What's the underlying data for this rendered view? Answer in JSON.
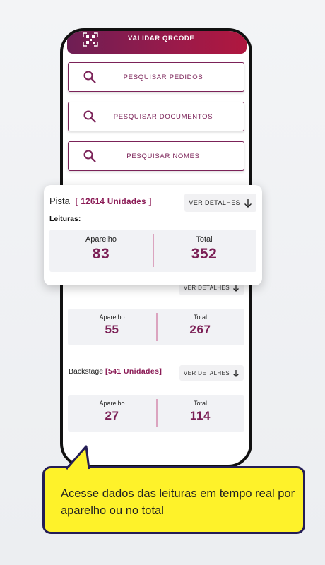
{
  "header": {
    "qr_label": "VALIDAR QRCODE",
    "icon": "qrcode-icon"
  },
  "search": {
    "orders_label": "PESQUISAR PEDIDOS",
    "documents_label": "PESQUISAR DOCUMENTOS",
    "names_label": "PESQUISAR NOMES",
    "icon": "search-icon"
  },
  "featured": {
    "name": "Pista",
    "units": "[ 12614 Unidades ]",
    "detail_label": "VER DETALHES",
    "readings_label": "Leituras:",
    "device_label": "Aparelho",
    "device_value": "83",
    "total_label": "Total",
    "total_value": "352"
  },
  "sections": [
    {
      "name": "",
      "units": "",
      "detail_label": "VER DETALHES",
      "device_label": "Aparelho",
      "device_value": "55",
      "total_label": "Total",
      "total_value": "267"
    },
    {
      "name": "Backstage",
      "units": "[541 Unidades]",
      "detail_label": "VER DETALHES",
      "device_label": "Aparelho",
      "device_value": "27",
      "total_label": "Total",
      "total_value": "114"
    }
  ],
  "callout": {
    "text": "Acesse dados das leituras em tempo real por aparelho ou no total"
  },
  "colors": {
    "brand": "#7b2258",
    "callout_bg": "#fef22a",
    "callout_border": "#241d56"
  }
}
